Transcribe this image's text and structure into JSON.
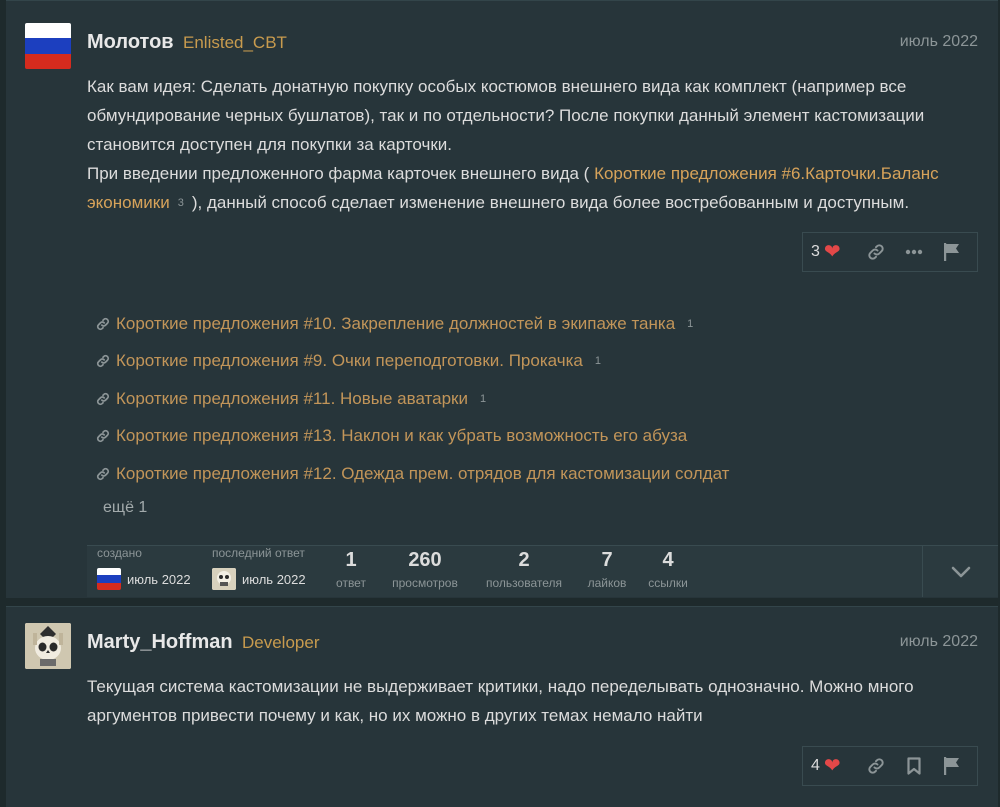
{
  "posts": [
    {
      "username": "Молотов",
      "user_title": "Enlisted_CBT",
      "date": "июль 2022",
      "paragraphs": {
        "p1": "Как вам идея: Сделать донатную покупку особых костюмов внешнего вида как комплект (например все обмундирование черных бушлатов), так и по отдельности? После покупки данный элемент кастомизации становится доступен для покупки за карточки.",
        "p2_before": "При введении предложенного фарма карточек внешнего вида (",
        "p2_link": "Короткие предложения #6.Карточки.Баланс экономики",
        "p2_link_clicks": "3",
        "p2_after": "), данный способ сделает изменение внешнего вида более востребованным и доступным."
      },
      "like_count": "3"
    },
    {
      "username": "Marty_Hoffman",
      "user_title": "Developer",
      "date": "июль 2022",
      "text": "Текущая система кастомизации не выдерживает критики, надо переделывать однозначно. Можно много аргументов привести почему и как, но их можно в других темах немало найти",
      "like_count": "4"
    }
  ],
  "related_links": [
    {
      "title": "Короткие предложения #10. Закрепление должностей в экипаже танка",
      "clicks": "1"
    },
    {
      "title": "Короткие предложения #9. Очки переподготовки. Прокачка",
      "clicks": "1"
    },
    {
      "title": "Короткие предложения #11. Новые аватарки",
      "clicks": "1"
    },
    {
      "title": "Короткие предложения #13. Наклон и как убрать возможность его абуза",
      "clicks": ""
    },
    {
      "title": "Короткие предложения #12. Одежда прем. отрядов для кастомизации солдат",
      "clicks": ""
    }
  ],
  "more_links": "ещё 1",
  "topic_map": {
    "created_label": "создано",
    "created_date": "июль 2022",
    "last_reply_label": "последний ответ",
    "last_reply_date": "июль 2022",
    "stats": [
      {
        "num": "1",
        "label": "ответ"
      },
      {
        "num": "260",
        "label": "просмотров"
      },
      {
        "num": "2",
        "label": "пользователя"
      },
      {
        "num": "7",
        "label": "лайков"
      },
      {
        "num": "4",
        "label": "ссылки"
      }
    ]
  },
  "colors": {
    "background": "#1e2a2c",
    "post_bg": "#27353a",
    "link": "#d7a35a",
    "title": "#c89b4e",
    "heart": "#e34848"
  }
}
